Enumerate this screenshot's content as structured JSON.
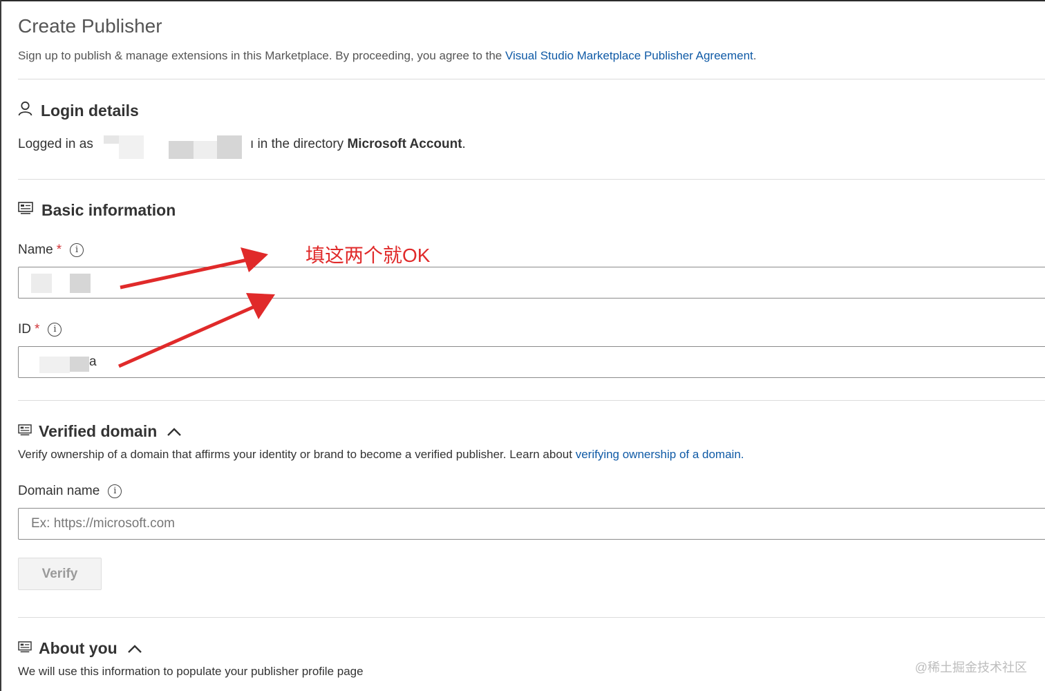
{
  "header": {
    "title": "Create Publisher",
    "subtitle_prefix": "Sign up to publish & manage extensions in this Marketplace. By proceeding, you agree to the ",
    "agreement_link": "Visual Studio Marketplace Publisher Agreement",
    "subtitle_suffix": "."
  },
  "login": {
    "heading": "Login details",
    "prefix": "Logged in as",
    "partial": "ı in the directory ",
    "directory": "Microsoft Account",
    "suffix": "."
  },
  "basic": {
    "heading": "Basic information",
    "name_label": "Name",
    "id_label": "ID",
    "required_mark": "*",
    "id_value_visible": "a"
  },
  "annotation": {
    "text": "填这两个就OK",
    "color": "#e02a2a"
  },
  "verified_domain": {
    "heading": "Verified domain",
    "description": "Verify ownership of a domain that affirms your identity or brand to become a verified publisher. Learn about ",
    "learn_link": "verifying ownership of a domain.",
    "domain_label": "Domain name",
    "domain_placeholder": "Ex: https://microsoft.com",
    "verify_button": "Verify"
  },
  "about": {
    "heading": "About you",
    "description": "We will use this information to populate your publisher profile page"
  },
  "watermark": "@稀土掘金技术社区",
  "icons": {
    "login": "person-icon",
    "basic": "form-icon",
    "domain": "form-icon",
    "about": "form-icon",
    "info": "info-icon",
    "collapse": "chevron-up-icon"
  },
  "colors": {
    "link": "#0f5aa6",
    "required": "#d13438",
    "annotation": "#e02a2a"
  }
}
